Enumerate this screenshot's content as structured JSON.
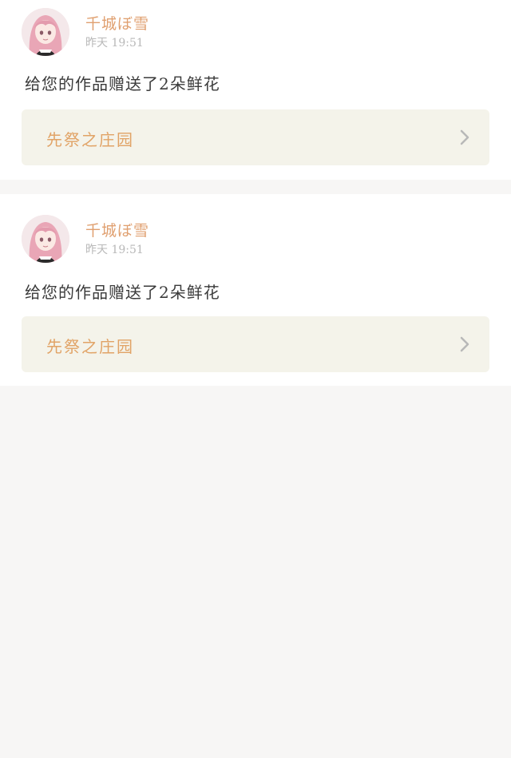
{
  "feed": {
    "items": [
      {
        "username": "千城ぼ雪",
        "time": "昨天 19:51",
        "message": "给您的作品赠送了2朵鲜花",
        "work_title": "先祭之庄园",
        "avatar_icon": "user-avatar-anime-girl"
      },
      {
        "username": "千城ぼ雪",
        "time": "昨天 19:51",
        "message": "给您的作品赠送了2朵鲜花",
        "work_title": "先祭之庄园",
        "avatar_icon": "user-avatar-anime-girl"
      }
    ]
  },
  "theme": {
    "page_background": "#f7f6f5",
    "card_background": "#ffffff",
    "username_color": "#e0a070",
    "link_text_color": "#e1a366",
    "link_background": "#f4f3ea"
  }
}
